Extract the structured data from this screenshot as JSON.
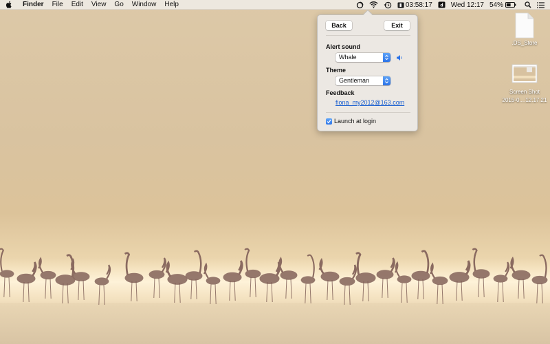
{
  "menubar": {
    "app_name": "Finder",
    "menus": [
      "File",
      "Edit",
      "View",
      "Go",
      "Window",
      "Help"
    ],
    "status": {
      "timer": "03:58:17",
      "clock": "Wed 12:17",
      "battery": "54%"
    }
  },
  "popover": {
    "back_label": "Back",
    "exit_label": "Exit",
    "alert_sound_label": "Alert sound",
    "alert_sound_value": "Whale",
    "theme_label": "Theme",
    "theme_value": "Gentleman",
    "feedback_label": "Feedback",
    "feedback_email": "fiona_my2012@163.com",
    "launch_label": "Launch at login",
    "launch_checked": true
  },
  "desktop": {
    "icons": [
      {
        "label": ".DS_Store",
        "label2": ""
      },
      {
        "label": "Screen Shot",
        "label2": "2015-0....12.17.21"
      }
    ]
  },
  "colors": {
    "accent": "#2b73e8",
    "link": "#1a5fd0"
  }
}
